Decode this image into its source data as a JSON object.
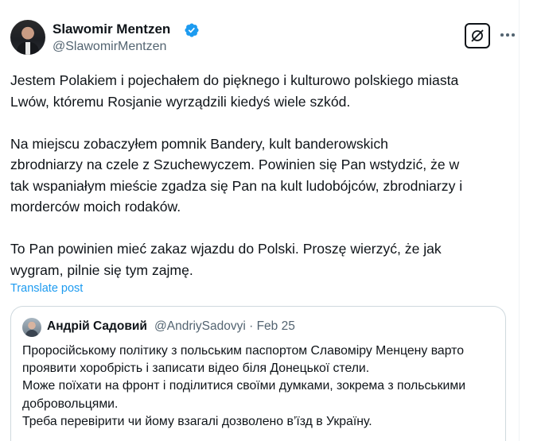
{
  "post": {
    "author": {
      "display_name": "Slawomir Mentzen",
      "handle": "@SlawomirMentzen",
      "verified_icon": "verified-badge-icon",
      "verified_color": "#1d9bf0"
    },
    "actions": {
      "grok_icon": "grok-icon",
      "more_icon": "more-options-icon"
    },
    "text_lines": [
      "Jestem Polakiem i pojechałem do pięknego i kulturowo polskiego miasta",
      "Lwów, któremu Rosjanie wyrządzili kiedyś wiele szkód.",
      "Na miejscu zobaczyłem pomnik Bandery, kult banderowskich",
      "zbrodniarzy na czele z Szuchewyczem. Powinien się Pan wstydzić, że w",
      "tak wspaniałym mieście zgadza się Pan na kult ludobójców, zbrodniarzy i",
      "morderców moich rodaków.",
      "To Pan powinien mieć zakaz wjazdu do Polski. Proszę wierzyć, że jak",
      "wygram, pilnie się tym zajmę."
    ],
    "translate_label": "Translate post",
    "link_color": "#1d9bf0"
  },
  "quote": {
    "display_name": "Андрій Садовий",
    "handle_date": "@AndriySadovyi · Feb 25",
    "text_lines": [
      "Проросійському політику з польським паспортом Славоміру Менцену варто",
      "проявити хоробрість і записати відео біля Донецької стели.",
      "Може поїхати на фронт і поділитися своїми думками, зокрема з польськими",
      "добровольцями.",
      "Треба перевірити чи йому взагалі дозволено в’їзд в Україну."
    ]
  }
}
